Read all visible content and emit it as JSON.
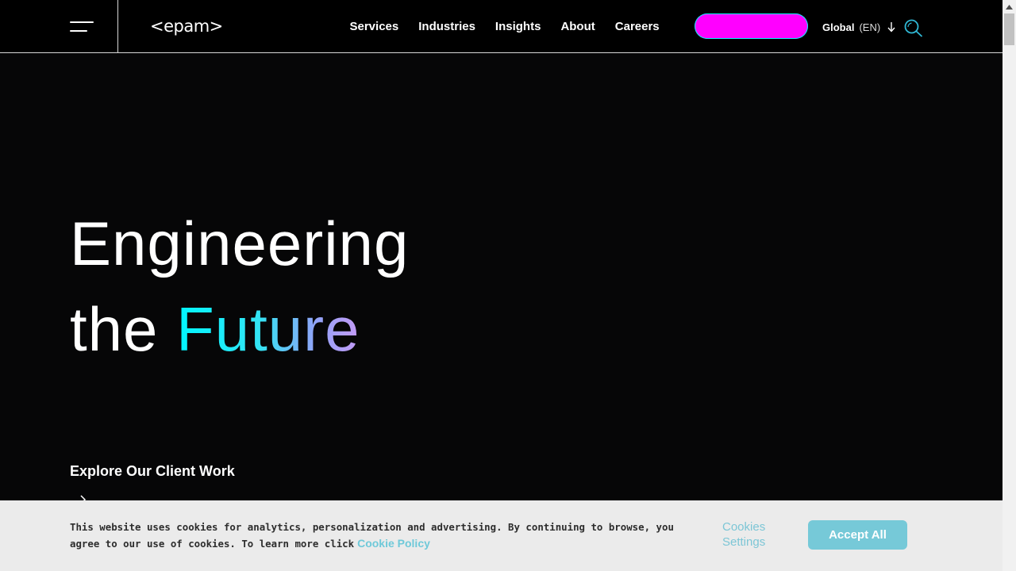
{
  "header": {
    "logo_text": "<epam>",
    "nav": [
      {
        "label": "Services"
      },
      {
        "label": "Industries"
      },
      {
        "label": "Insights"
      },
      {
        "label": "About"
      },
      {
        "label": "Careers"
      }
    ],
    "cta_color": "#ff00ff",
    "locale_label": "Global",
    "locale_lang": "(EN)"
  },
  "hero": {
    "line1": "Engineering",
    "line2_prefix": "the ",
    "line2_accent": "Future",
    "explore_label": "Explore Our Client Work"
  },
  "cookie_banner": {
    "text": "This website uses cookies for analytics, personalization and advertising. By continuing to browse, you agree to our use of cookies. To learn more click",
    "policy_link": "Cookie Policy",
    "settings_label": "Cookies Settings",
    "accept_label": "Accept All",
    "accent_color": "#76c9d8"
  },
  "icons": {
    "menu": "hamburger-icon",
    "locale_arrow": "arrow-down-icon",
    "search": "search-icon",
    "explore": "arrow-right-icon"
  },
  "colors": {
    "background": "#060607",
    "gradient": [
      "#00f6ff",
      "#c59af6"
    ]
  }
}
